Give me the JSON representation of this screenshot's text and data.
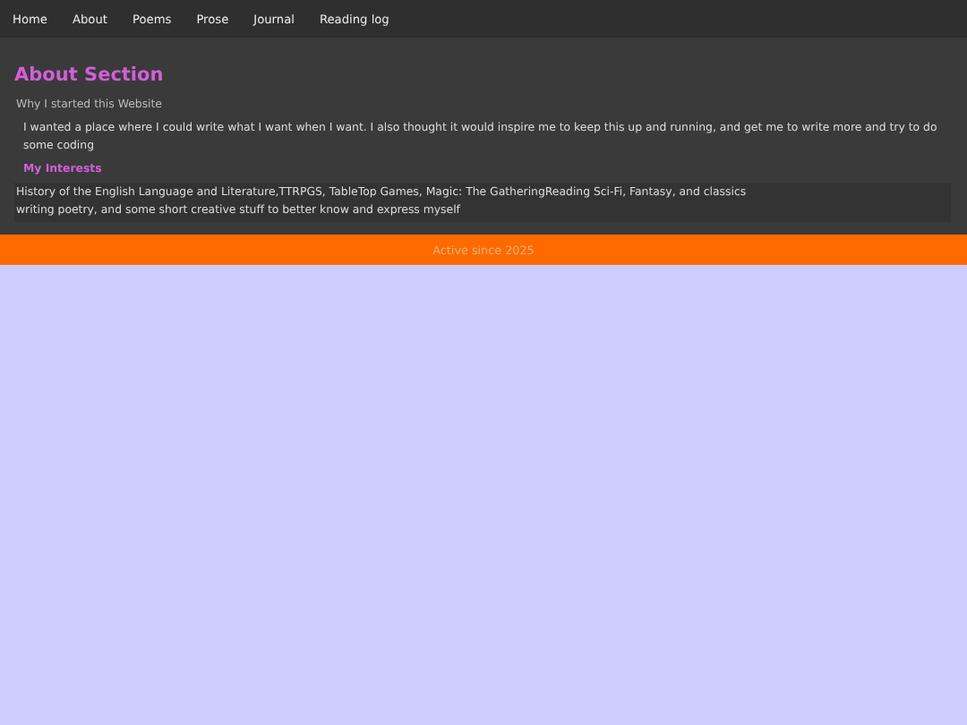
{
  "nav": [
    {
      "label": "Home"
    },
    {
      "label": "About"
    },
    {
      "label": "Poems"
    },
    {
      "label": "Prose"
    },
    {
      "label": "Journal"
    },
    {
      "label": "Reading log"
    }
  ],
  "section": {
    "title": "About Section",
    "subtitle": "Why I started this Website",
    "body": "I wanted a place where I could write what I want when I want. I also thought it would inspire me to keep this up and running, and get me to write more and try to do some coding",
    "interests_heading": "My Interests",
    "interests": [
      "History of the English Language and Literature,TTRPGS, TableTop Games, Magic: The GatheringReading Sci-Fi, Fantasy, and classics",
      "writing poetry, and some short creative stuff to better know and express myself"
    ]
  },
  "footer": {
    "text": "Active since 2025"
  }
}
